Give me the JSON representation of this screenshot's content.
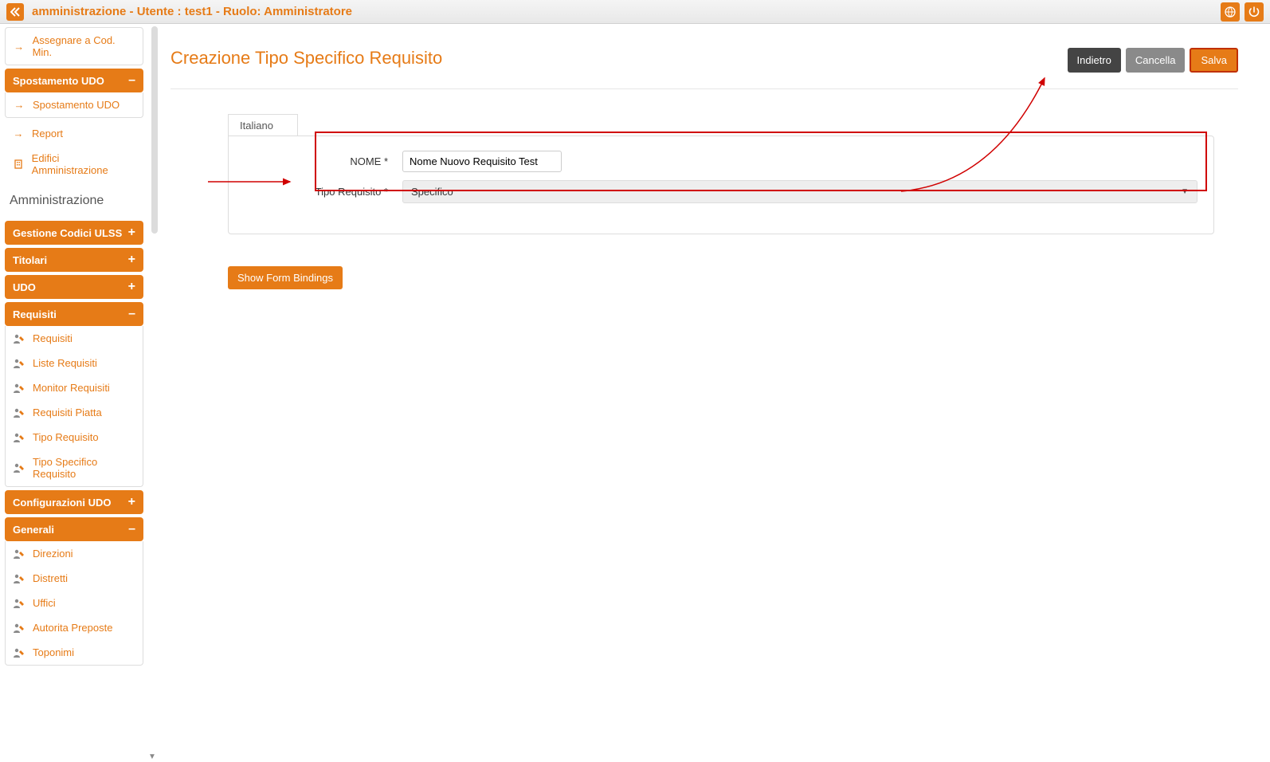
{
  "topbar": {
    "title": "amministrazione - Utente : test1 - Ruolo: Amministratore"
  },
  "sidebar": {
    "topPanel": {
      "items": [
        {
          "label": "Assegnare a Cod. Min."
        }
      ]
    },
    "spostamento": {
      "title": "Spostamento UDO",
      "toggle": "–",
      "items": [
        {
          "label": "Spostamento UDO"
        }
      ]
    },
    "looseItems": [
      {
        "label": "Report",
        "icon": "arrow"
      },
      {
        "label": "Edifici Amministrazione",
        "icon": "building"
      }
    ],
    "adminTitle": "Amministrazione",
    "gestione": {
      "title": "Gestione Codici ULSS",
      "toggle": "+"
    },
    "titolari": {
      "title": "Titolari",
      "toggle": "+"
    },
    "udo": {
      "title": "UDO",
      "toggle": "+"
    },
    "requisiti": {
      "title": "Requisiti",
      "toggle": "–",
      "items": [
        {
          "label": "Requisiti"
        },
        {
          "label": "Liste Requisiti"
        },
        {
          "label": "Monitor Requisiti"
        },
        {
          "label": "Requisiti Piatta"
        },
        {
          "label": "Tipo Requisito"
        },
        {
          "label": "Tipo Specifico Requisito"
        }
      ]
    },
    "configurazioni": {
      "title": "Configurazioni UDO",
      "toggle": "+"
    },
    "generali": {
      "title": "Generali",
      "toggle": "–",
      "items": [
        {
          "label": "Direzioni"
        },
        {
          "label": "Distretti"
        },
        {
          "label": "Uffici"
        },
        {
          "label": "Autorita Preposte"
        },
        {
          "label": "Toponimi"
        }
      ]
    }
  },
  "page": {
    "title": "Creazione Tipo Specifico Requisito",
    "buttons": {
      "back": "Indietro",
      "cancel": "Cancella",
      "save": "Salva"
    }
  },
  "form": {
    "tab": "Italiano",
    "nomeLabel": "NOME *",
    "nomeValue": "Nome Nuovo Requisito Test",
    "tipoLabel": "Tipo Requisito *",
    "tipoValue": "Specifico",
    "showBindings": "Show Form Bindings"
  }
}
